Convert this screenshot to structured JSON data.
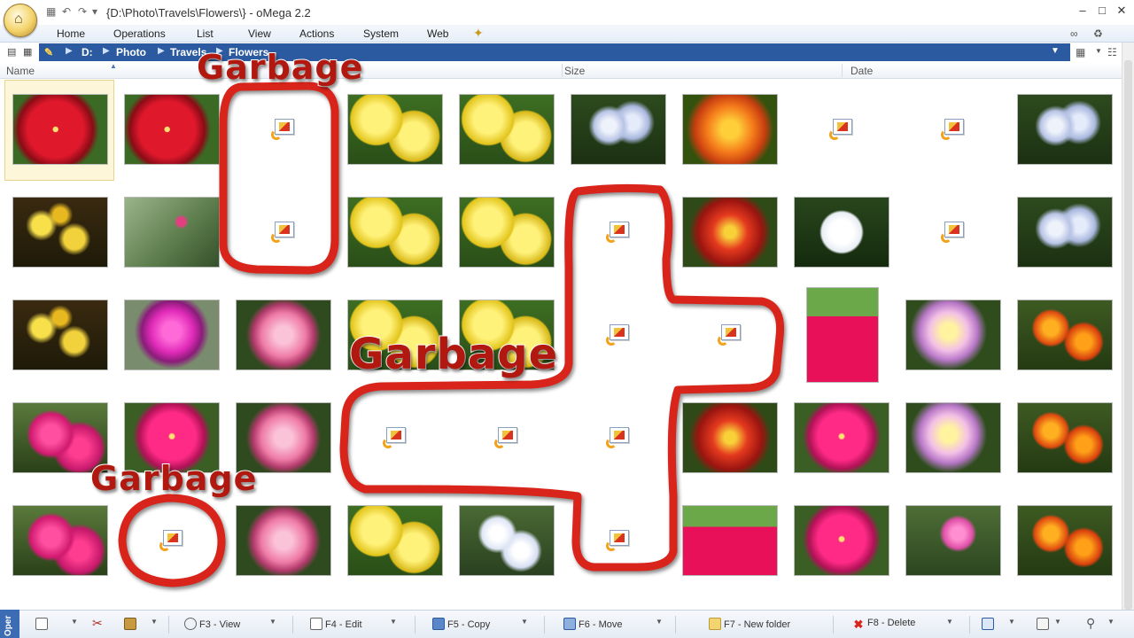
{
  "window": {
    "title": "{D:\\Photo\\Travels\\Flowers\\} - oMega 2.2",
    "minimize": "–",
    "maximize": "□",
    "close": "✕"
  },
  "menu": [
    "Home",
    "Operations",
    "List",
    "View",
    "Actions",
    "System",
    "Web"
  ],
  "breadcrumb": [
    "D:",
    "Photo",
    "Travels",
    "Flowers"
  ],
  "columns": {
    "name": "Name",
    "size": "Size",
    "date": "Date"
  },
  "annotations": {
    "label": "Garbage"
  },
  "thumbnails": [
    [
      "hibiscus-red",
      "hibiscus-red",
      "broken",
      "yellow-bells",
      "yellow-bells",
      "plumbago-blue",
      "lantana-orange",
      "broken",
      "broken",
      "plumbago-blue"
    ],
    [
      "yellow-cluster",
      "pink-shrub",
      "broken",
      "yellow-bells",
      "yellow-bells",
      "broken",
      "lantana-red",
      "periwinkle-white",
      "broken",
      "plumbago-blue"
    ],
    [
      "yellow-cluster",
      "magenta-rose",
      "pink-camellia",
      "yellow-bells",
      "yellow-bells",
      "broken",
      "broken",
      "hibiscus-stamen",
      "lantana-pastel",
      "marigold-orange"
    ],
    [
      "bougainvillea",
      "hibiscus-pink",
      "pink-camellia",
      "broken",
      "broken",
      "broken",
      "lantana-red",
      "hibiscus-pink",
      "lantana-pastel",
      "marigold-orange"
    ],
    [
      "bougainvillea",
      "broken",
      "pink-camellia",
      "yellow-bells",
      "plumbago-white",
      "broken",
      "hibiscus-stamen",
      "hibiscus-pink",
      "periwinkle-pink",
      "marigold-orange"
    ]
  ],
  "toolbar": {
    "ops_tab": "Oper",
    "view": "F3 - View",
    "edit": "F4 - Edit",
    "copy": "F5 - Copy",
    "move": "F6 - Move",
    "new_folder": "F7 - New folder",
    "delete": "F8 - Delete"
  }
}
